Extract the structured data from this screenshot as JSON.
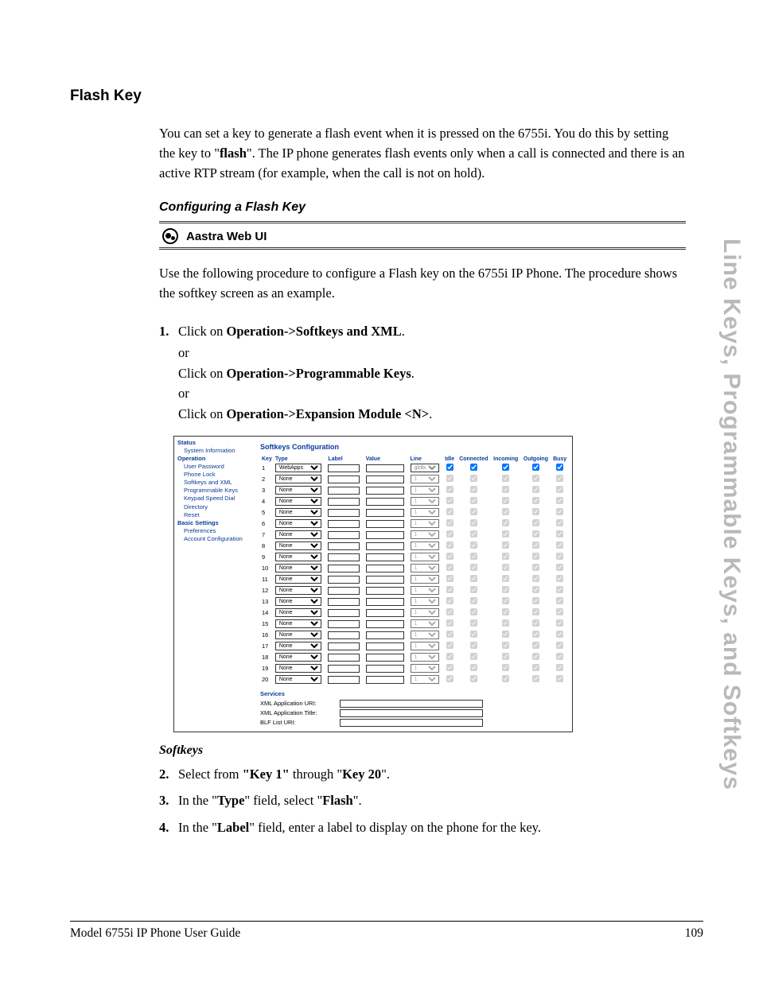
{
  "side_title": "Line Keys, Programmable Keys, and Softkeys",
  "section_title": "Flash Key",
  "intro_p1_a": "You can set a key to generate a flash event when it is pressed on the 6755i. You do this by setting the key to \"",
  "intro_p1_flash": "flash",
  "intro_p1_b": "\". The IP phone generates flash events only when a call is connected and there is an active RTP stream (for example, when the call is not on hold).",
  "sub_heading": "Configuring a Flash Key",
  "header_bar": "Aastra Web UI",
  "intro_p2": "Use the following procedure to configure a Flash key on the 6755i IP Phone. The procedure shows the softkey screen as an example.",
  "step1": {
    "num": "1.",
    "a_pre": "Click on ",
    "a_bold": "Operation->Softkeys and XML",
    "a_post": ".",
    "or": "or",
    "b_pre": "Click on ",
    "b_bold": "Operation->Programmable Keys",
    "b_post": ".",
    "c_pre": "Click on ",
    "c_bold": "Operation->Expansion Module <N>",
    "c_post": "."
  },
  "webui": {
    "nav": {
      "status": "Status",
      "sysinfo": "System Information",
      "operation": "Operation",
      "items_op": [
        "User Password",
        "Phone Lock",
        "Softkeys and XML",
        "Programmable Keys",
        "Keypad Speed Dial",
        "Directory",
        "Reset"
      ],
      "basic": "Basic Settings",
      "items_bs": [
        "Preferences",
        "Account Configuration"
      ]
    },
    "title": "Softkeys Configuration",
    "cols": [
      "Key",
      "Type",
      "Label",
      "Value",
      "Line",
      "Idle",
      "Connected",
      "Incoming",
      "Outgoing",
      "Busy"
    ],
    "rows": [
      {
        "k": "1",
        "type": "WebApps",
        "line": "global",
        "en": true
      },
      {
        "k": "2",
        "type": "None",
        "line": "1",
        "en": false
      },
      {
        "k": "3",
        "type": "None",
        "line": "1",
        "en": false
      },
      {
        "k": "4",
        "type": "None",
        "line": "1",
        "en": false
      },
      {
        "k": "5",
        "type": "None",
        "line": "1",
        "en": false
      },
      {
        "k": "6",
        "type": "None",
        "line": "1",
        "en": false
      },
      {
        "k": "7",
        "type": "None",
        "line": "1",
        "en": false
      },
      {
        "k": "8",
        "type": "None",
        "line": "1",
        "en": false
      },
      {
        "k": "9",
        "type": "None",
        "line": "1",
        "en": false
      },
      {
        "k": "10",
        "type": "None",
        "line": "1",
        "en": false
      },
      {
        "k": "11",
        "type": "None",
        "line": "1",
        "en": false
      },
      {
        "k": "12",
        "type": "None",
        "line": "1",
        "en": false
      },
      {
        "k": "13",
        "type": "None",
        "line": "1",
        "en": false
      },
      {
        "k": "14",
        "type": "None",
        "line": "1",
        "en": false
      },
      {
        "k": "15",
        "type": "None",
        "line": "1",
        "en": false
      },
      {
        "k": "16",
        "type": "None",
        "line": "1",
        "en": false
      },
      {
        "k": "17",
        "type": "None",
        "line": "1",
        "en": false
      },
      {
        "k": "18",
        "type": "None",
        "line": "1",
        "en": false
      },
      {
        "k": "19",
        "type": "None",
        "line": "1",
        "en": false
      },
      {
        "k": "20",
        "type": "None",
        "line": "1",
        "en": false
      }
    ],
    "services": {
      "hdr": "Services",
      "f1": "XML Application URI:",
      "f2": "XML Application Title:",
      "f3": "BLF List URI:"
    }
  },
  "softkeys_h": "Softkeys",
  "step2": {
    "num": "2.",
    "a": "Select from ",
    "b": "\"Key 1\"",
    "c": " through \"",
    "d": "Key 20",
    "e": "\"."
  },
  "step3": {
    "num": "3.",
    "a": "In the \"",
    "b": "Type",
    "c": "\" field, select \"",
    "d": "Flash",
    "e": "\"."
  },
  "step4": {
    "num": "4.",
    "a": "In the \"",
    "b": "Label",
    "c": "\" field, enter a label to display on the phone for the key."
  },
  "footer": {
    "left": "Model 6755i IP Phone User Guide",
    "right": "109"
  }
}
